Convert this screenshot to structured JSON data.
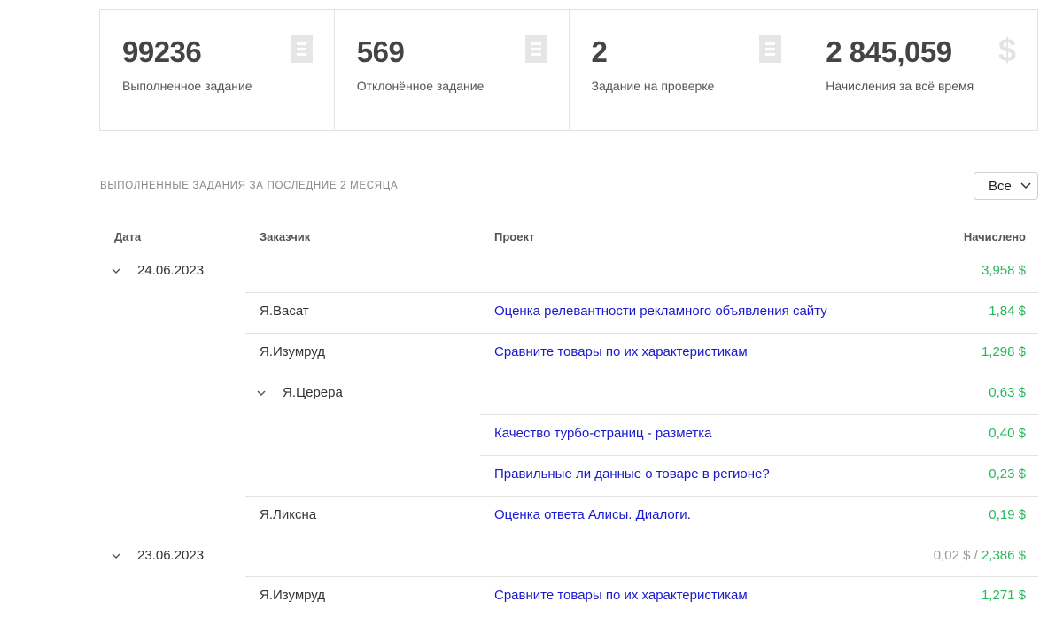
{
  "stats": [
    {
      "value": "99236",
      "label": "Выполненное задание",
      "icon": "document-icon"
    },
    {
      "value": "569",
      "label": "Отклонённое задание",
      "icon": "document-icon"
    },
    {
      "value": "2",
      "label": "Задание на проверке",
      "icon": "document-icon"
    },
    {
      "value": "2 845,059",
      "label": "Начисления за всё время",
      "icon": "dollar-icon",
      "icon_glyph": "$"
    }
  ],
  "section": {
    "title": "Выполненные задания за последние 2 месяца",
    "filter_value": "Все"
  },
  "table": {
    "headers": {
      "date": "Дата",
      "customer": "Заказчик",
      "project": "Проект",
      "earned": "Начислено"
    },
    "groups": [
      {
        "date": "24.06.2023",
        "total": "3,958 $",
        "rows": [
          {
            "customer": "Я.Васат",
            "project": "Оценка релевантности рекламного объявления сайту",
            "amount": "1,84 $"
          },
          {
            "customer": "Я.Изумруд",
            "project": "Сравните товары по их характеристикам",
            "amount": "1,298 $"
          },
          {
            "customer": "Я.Церера",
            "amount": "0,63 $",
            "subrows": [
              {
                "project": "Качество турбо-страниц - разметка",
                "amount": "0,40 $"
              },
              {
                "project": "Правильные ли данные о товаре в регионе?",
                "amount": "0,23 $"
              }
            ]
          },
          {
            "customer": "Я.Ликсна",
            "project": "Оценка ответа Алисы. Диалоги.",
            "amount": "0,19 $"
          }
        ]
      },
      {
        "date": "23.06.2023",
        "total_pending": "0,02 $",
        "total_separator": "/",
        "total": "2,386 $",
        "rows": [
          {
            "customer": "Я.Изумруд",
            "project": "Сравните товары по их характеристикам",
            "amount": "1,271 $"
          }
        ]
      }
    ]
  },
  "colors": {
    "amount": "#26b85a",
    "link": "#1a1acc",
    "muted": "#999999",
    "border": "#e2e2e2"
  }
}
